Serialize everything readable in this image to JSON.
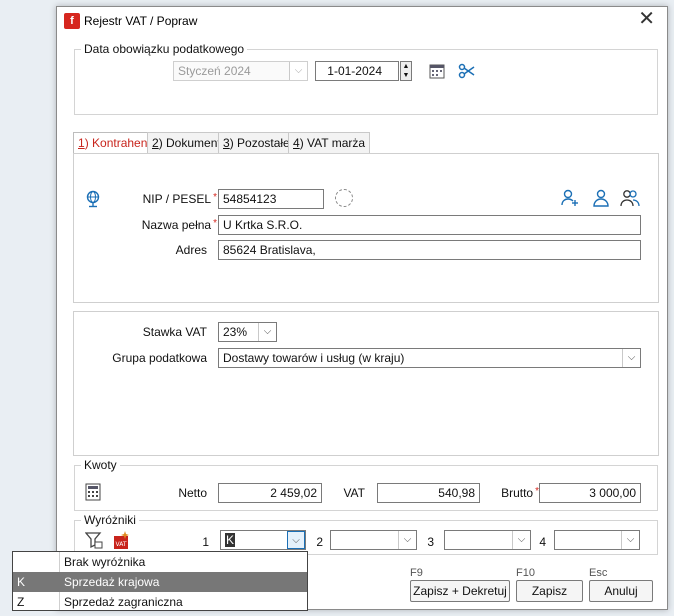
{
  "window": {
    "title": "Rejestr VAT / Popraw",
    "close_icon": "close-icon"
  },
  "tax_obligation": {
    "legend": "Data obowiązku podatkowego",
    "month_value": "Styczeń 2024",
    "date_value": "1-01-2024"
  },
  "tabs": [
    {
      "num": "1",
      "label": ") Kontrahent"
    },
    {
      "num": "2",
      "label": ") Dokument"
    },
    {
      "num": "3",
      "label": ") Pozostałe"
    },
    {
      "num": "4",
      "label": ") VAT marża"
    }
  ],
  "contractor": {
    "nip_label": "NIP / PESEL",
    "nip_value": "54854123",
    "name_label": "Nazwa pełna",
    "name_value": "U Krtka S.R.O.",
    "address_label": "Adres",
    "address_value": "85624 Bratislava,"
  },
  "vat": {
    "rate_label": "Stawka VAT",
    "rate_value": "23%",
    "group_label": "Grupa podatkowa",
    "group_value": "Dostawy towarów i usług (w kraju)"
  },
  "amounts": {
    "legend": "Kwoty",
    "net_label": "Netto",
    "net_value": "2 459,02",
    "vat_label": "VAT",
    "vat_value": "540,98",
    "gross_label": "Brutto",
    "gross_value": "3 000,00"
  },
  "markers": {
    "legend": "Wyróżniki",
    "n1": "1",
    "n2": "2",
    "n3": "3",
    "n4": "4",
    "v1": "K"
  },
  "dropdown_options": [
    {
      "key": "",
      "label": "Brak wyróżnika"
    },
    {
      "key": "K",
      "label": "Sprzedaż krajowa"
    },
    {
      "key": "Z",
      "label": "Sprzedaż zagraniczna"
    }
  ],
  "buttons": {
    "f9": "F9",
    "f10": "F10",
    "esc": "Esc",
    "save_decree": "Zapisz + Dekretuj",
    "save": "Zapisz",
    "cancel": "Anuluj"
  },
  "colors": {
    "accent": "#c8241c",
    "selected_row": "#777777"
  }
}
